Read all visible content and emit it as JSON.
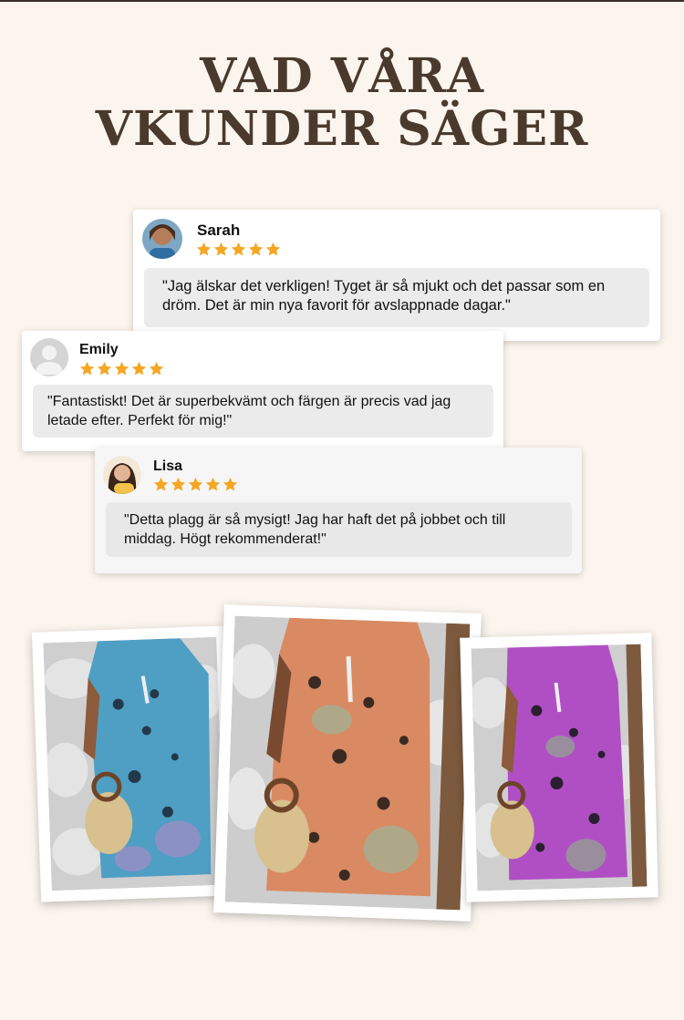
{
  "heading": {
    "line1": "VAD VÅRA",
    "line2": "VKUNDER SÄGER"
  },
  "reviews": [
    {
      "name": "Sarah",
      "rating": 5,
      "text": "\"Jag älskar det verkligen! Tyget är så mjukt och det passar som en dröm. Det är min nya favorit för avslappnade dagar.\""
    },
    {
      "name": "Emily",
      "rating": 5,
      "text": "\"Fantastiskt! Det är superbekvämt och färgen är precis vad jag letade efter. Perfekt för mig!\""
    },
    {
      "name": "Lisa",
      "rating": 5,
      "text": "\"Detta plagg är så mysigt! Jag har haft det på jobbet och till middag. Högt rekommenderat!\""
    }
  ],
  "colors": {
    "star": "#f5a623",
    "title": "#4a3a2e",
    "background": "#fbf5ee"
  },
  "photos": [
    {
      "variant": "blue-dress"
    },
    {
      "variant": "orange-dress"
    },
    {
      "variant": "purple-dress"
    }
  ]
}
